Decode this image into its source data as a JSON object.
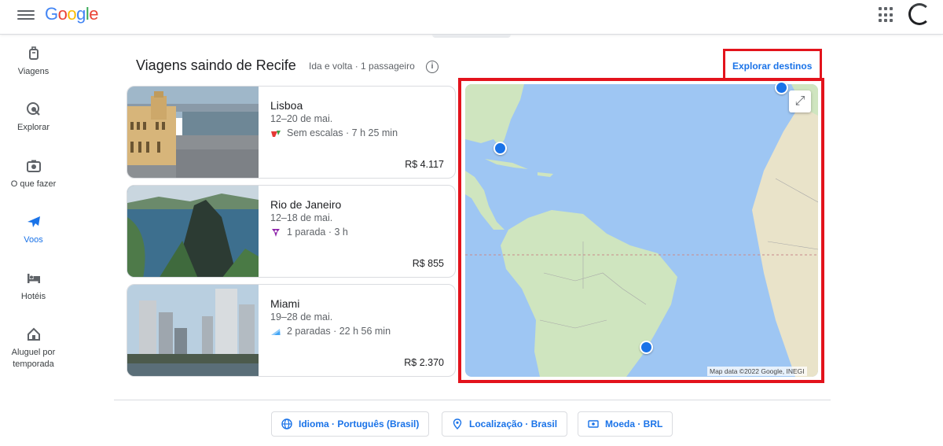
{
  "header": {
    "logo": {
      "G": "G",
      "o1": "o",
      "o2": "o",
      "g": "g",
      "l": "l",
      "e": "e"
    }
  },
  "sidebar": {
    "items": [
      {
        "label": "Viagens",
        "icon": "suitcase-icon"
      },
      {
        "label": "Explorar",
        "icon": "explore-icon"
      },
      {
        "label": "O que fazer",
        "icon": "camera-icon"
      },
      {
        "label": "Voos",
        "icon": "plane-icon",
        "active": true
      },
      {
        "label": "Hotéis",
        "icon": "bed-icon"
      },
      {
        "label": "Aluguel por temporada",
        "icon": "house-icon"
      }
    ]
  },
  "main": {
    "title": "Viagens saindo de Recife",
    "subtitle": "Ida e volta · 1 passageiro",
    "info_glyph": "i",
    "explore_link": "Explorar destinos",
    "trips": [
      {
        "city": "Lisboa",
        "dates": "12–20 de mai.",
        "stops": "Sem escalas · 7 h 25 min",
        "price": "R$ 4.117"
      },
      {
        "city": "Rio de Janeiro",
        "dates": "12–18 de mai.",
        "stops": "1 parada · 3 h",
        "price": "R$ 855"
      },
      {
        "city": "Miami",
        "dates": "19–28 de mai.",
        "stops": "2 paradas · 22 h 56 min",
        "price": "R$ 2.370"
      }
    ]
  },
  "map": {
    "credit": "Map data ©2022 Google, INEGI",
    "expand_glyph": "⤢"
  },
  "footer": {
    "language": "Idioma · Português (Brasil)",
    "location": "Localização · Brasil",
    "currency": "Moeda · BRL"
  },
  "colors": {
    "accent": "#1a73e8",
    "highlight": "#e3131c",
    "ocean": "#9ec6f3",
    "land": "#cfe5bf"
  }
}
